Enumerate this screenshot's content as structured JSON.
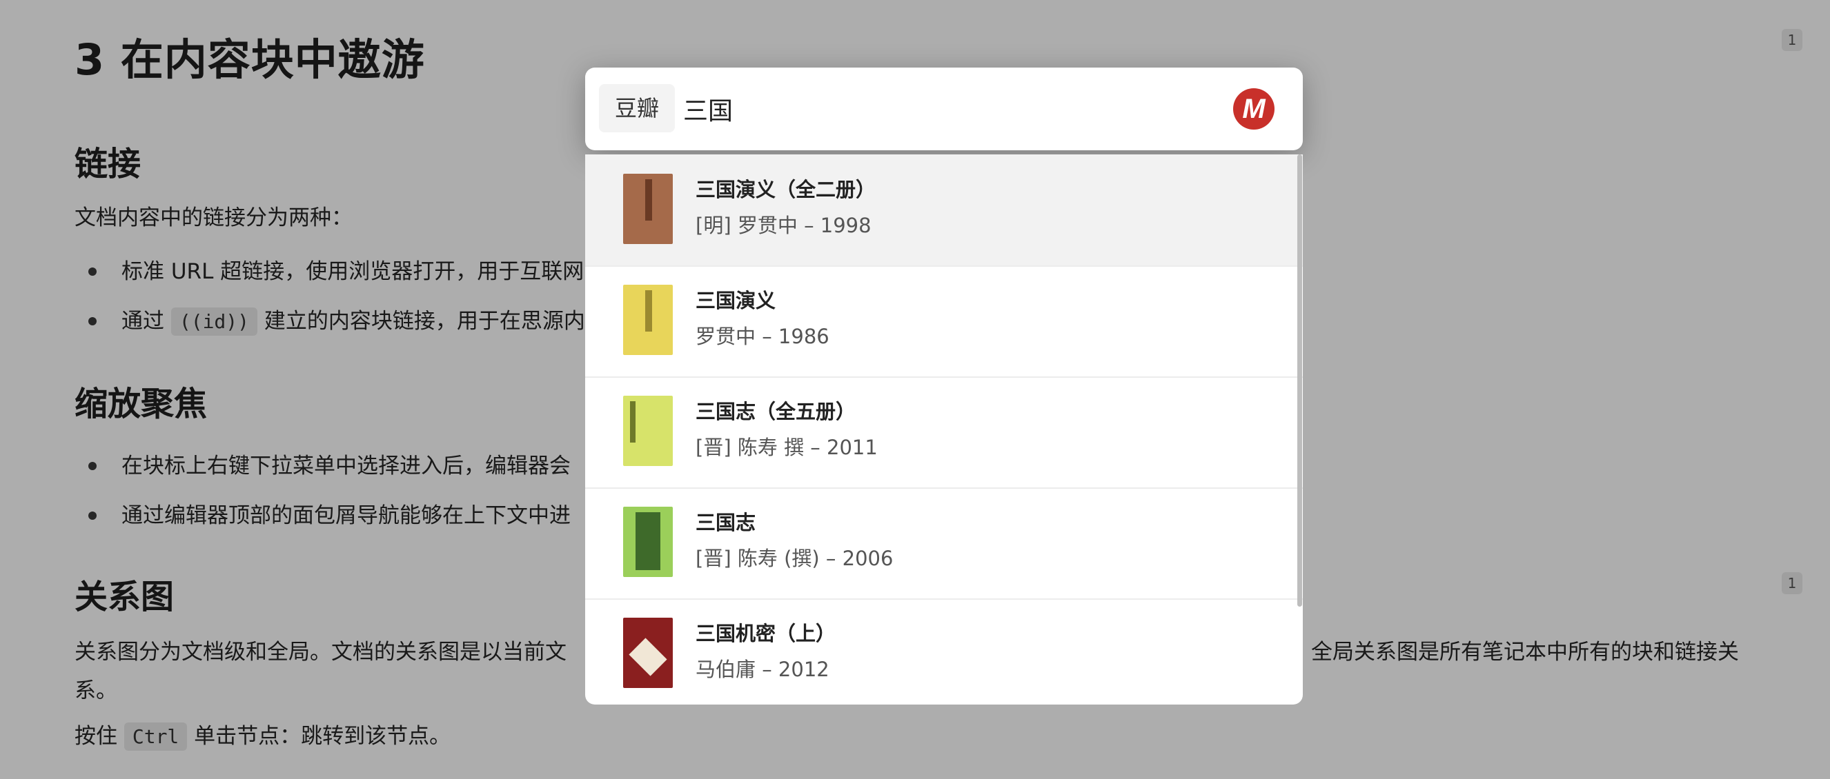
{
  "doc": {
    "h1": "3 在内容块中遨游",
    "sections": [
      {
        "heading": "链接",
        "intro": "文档内容中的链接分为两种：",
        "bullets": [
          {
            "text": "标准 URL 超链接，使用浏览器打开，用于互联网"
          },
          {
            "pre": "通过 ",
            "code": "((id))",
            "post": " 建立的内容块链接，用于在思源内"
          }
        ]
      },
      {
        "heading": "缩放聚焦",
        "bullets": [
          {
            "text": "在块标上右键下拉菜单中选择进入后，编辑器会"
          },
          {
            "text": "通过编辑器顶部的面包屑导航能够在上下文中进"
          }
        ]
      },
      {
        "heading": "关系图",
        "para1_left": "关系图分为文档级和全局。文档的关系图是以当前文",
        "para1_right": "全局关系图是所有笔记本中所有的块和链接关",
        "para1_wrap": "系。",
        "para2_pre": "按住 ",
        "para2_code": "Ctrl",
        "para2_post": " 单击节点：跳转到该节点。"
      }
    ],
    "badges": [
      "1",
      "1"
    ]
  },
  "search": {
    "source_tag": "豆瓣",
    "query": "三国",
    "icon": "m-logo-icon",
    "icon_letter": "M"
  },
  "results": [
    {
      "title": "三国演义（全二册）",
      "subtitle": "[明] 罗贯中 – 1998",
      "cover_color": "#a56a4a",
      "selected": true
    },
    {
      "title": "三国演义",
      "subtitle": "罗贯中 – 1986",
      "cover_color": "#e8d55a",
      "selected": false
    },
    {
      "title": "三国志（全五册）",
      "subtitle": "[晋] 陈寿 撰 – 2011",
      "cover_color": "#d7e36a",
      "selected": false
    },
    {
      "title": "三国志",
      "subtitle": "[晋] 陈寿 (撰) – 2006",
      "cover_color": "#9bcf5a",
      "selected": false
    },
    {
      "title": "三国机密（上）",
      "subtitle": "马伯庸 – 2012",
      "cover_color": "#8a1f1f",
      "selected": false
    }
  ],
  "colors": {
    "accent": "#c8302a",
    "selected_row": "#f2f2f2"
  }
}
